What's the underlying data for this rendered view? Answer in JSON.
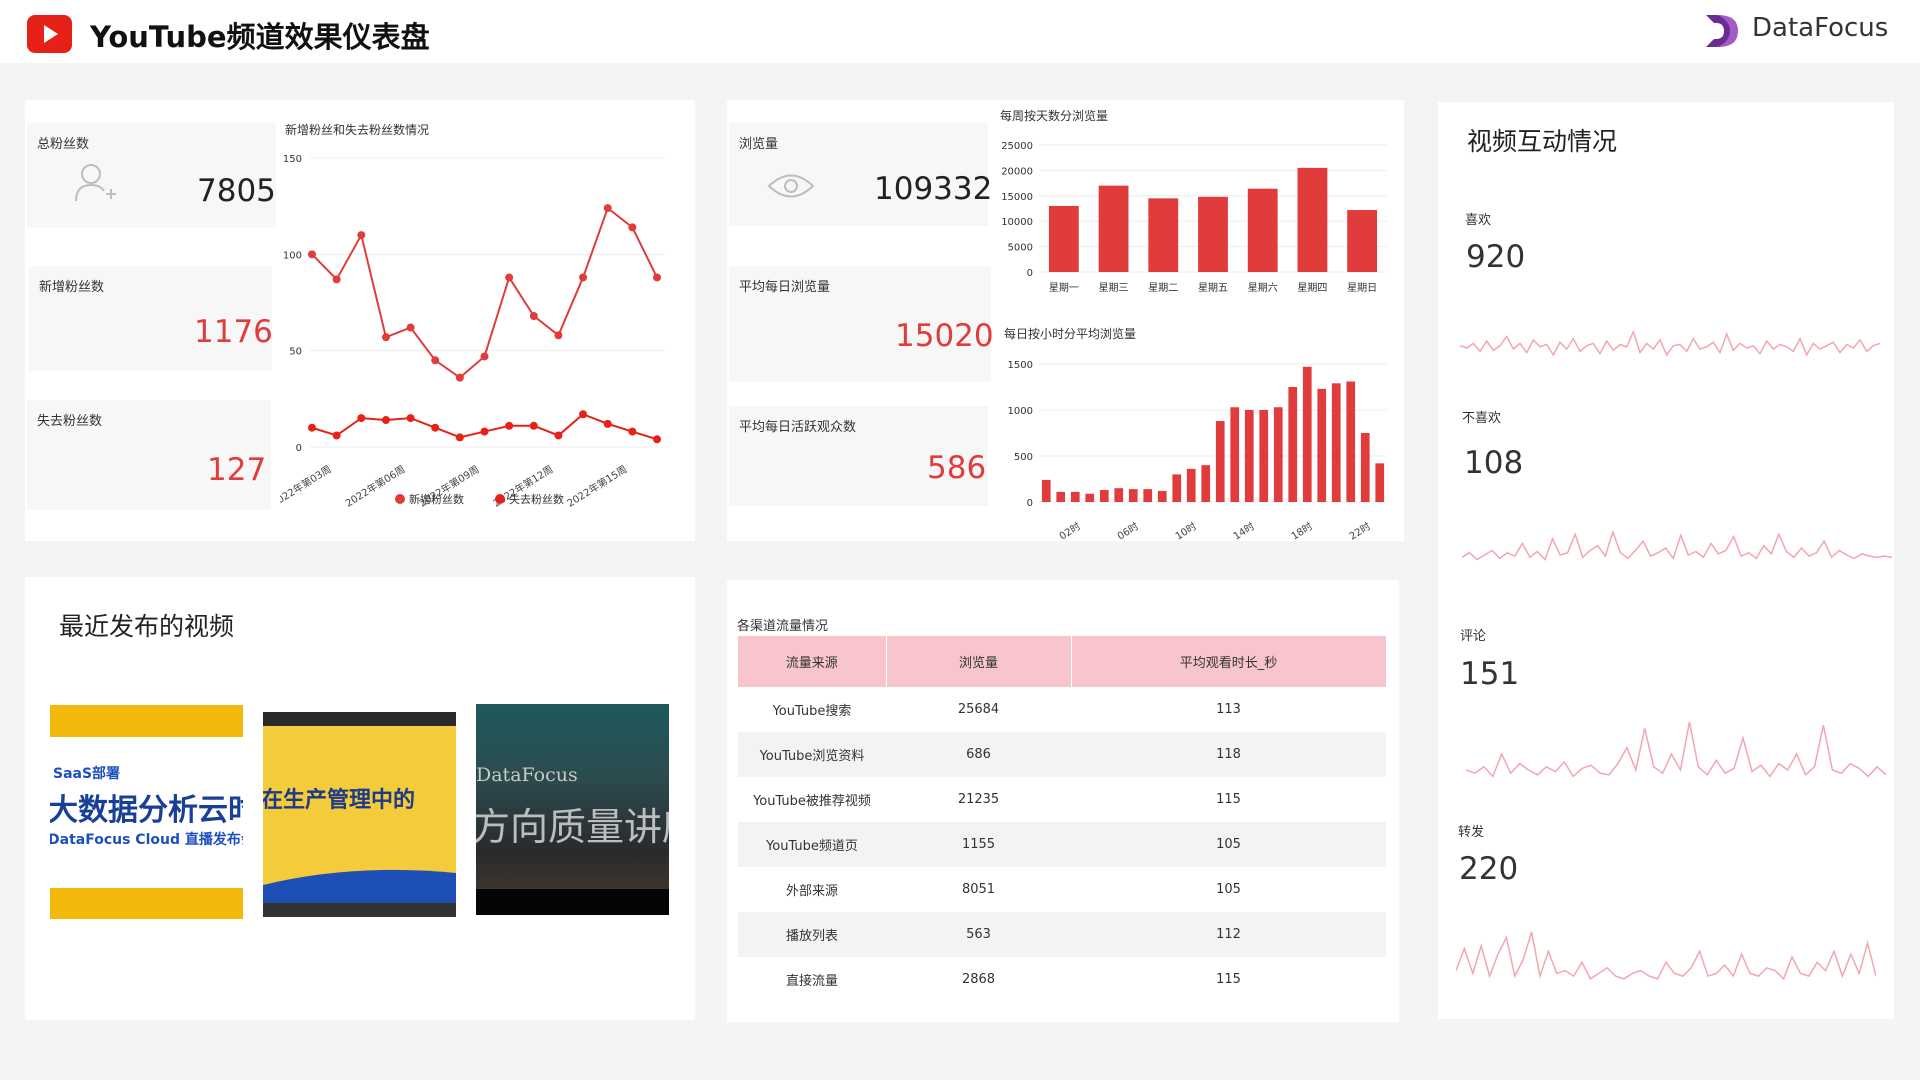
{
  "header": {
    "title": "YouTube频道效果仪表盘",
    "brand": "DataFocus"
  },
  "colors": {
    "accent": "#e03c3c",
    "youtube_red": "#e62117",
    "header_pink": "#f7c5cb",
    "sparkline": "#f4a5ae",
    "brand_purple": "#6a2c91"
  },
  "fans": {
    "total_label": "总粉丝数",
    "total_value": "7805",
    "total_icon": "user-add-icon",
    "new_label": "新增粉丝数",
    "new_value": "1176",
    "lost_label": "失去粉丝数",
    "lost_value": "127"
  },
  "views": {
    "views_label": "浏览量",
    "views_value": "109332",
    "views_icon": "eye-icon",
    "avg_daily_label": "平均每日浏览量",
    "avg_daily_value": "15020",
    "avg_active_label": "平均每日活跃观众数",
    "avg_active_value": "586"
  },
  "interaction": {
    "title": "视频互动情况",
    "like_label": "喜欢",
    "like_value": "920",
    "dislike_label": "不喜欢",
    "dislike_value": "108",
    "comment_label": "评论",
    "comment_value": "151",
    "share_label": "转发",
    "share_value": "220"
  },
  "recent": {
    "title": "最近发布的视频",
    "video1": {
      "line1": "SaaS部署",
      "line2": "大数据分析云时",
      "line3": "DataFocus Cloud 直播发布会"
    },
    "video2": {
      "line1": "在生产管理中的"
    },
    "video3": {
      "line1": "DataFocus",
      "line2": "方向质量讲座"
    }
  },
  "traffic": {
    "title": "各渠道流量情况",
    "columns": [
      "流量来源",
      "浏览量",
      "平均观看时长_秒"
    ],
    "rows": [
      [
        "YouTube搜索",
        "25684",
        "113"
      ],
      [
        "YouTube浏览资料",
        "686",
        "118"
      ],
      [
        "YouTube被推荐视频",
        "21235",
        "115"
      ],
      [
        "YouTube频道页",
        "1155",
        "105"
      ],
      [
        "外部来源",
        "8051",
        "105"
      ],
      [
        "播放列表",
        "563",
        "112"
      ],
      [
        "直接流量",
        "2868",
        "115"
      ]
    ]
  },
  "chart_data": [
    {
      "id": "fans",
      "type": "line",
      "title": "新增粉丝和失去粉丝数情况",
      "ylim": [
        0,
        150
      ],
      "yticks": [
        0,
        50,
        100,
        150
      ],
      "x": [
        "2022年第01周",
        "2022年第02周",
        "2022年第03周",
        "2022年第04周",
        "2022年第05周",
        "2022年第06周",
        "2022年第07周",
        "2022年第08周",
        "2022年第09周",
        "2022年第10周",
        "2022年第11周",
        "2022年第12周",
        "2022年第13周",
        "2022年第14周",
        "2022年第15周",
        "2022年第16周"
      ],
      "x_tick_labels": [
        "2022年第03周",
        "2022年第06周",
        "2022年第09周",
        "2022年第12周",
        "2022年第15周"
      ],
      "series": [
        {
          "name": "新增粉丝数",
          "color": "#e03c3c",
          "values": [
            100,
            87,
            110,
            57,
            62,
            45,
            36,
            47,
            88,
            68,
            58,
            88,
            124,
            114,
            88
          ]
        },
        {
          "name": "失去粉丝数",
          "color": "#e62117",
          "values": [
            10,
            6,
            15,
            14,
            15,
            10,
            5,
            8,
            11,
            11,
            6,
            17,
            12,
            8,
            4
          ]
        }
      ],
      "legend": "bottom"
    },
    {
      "id": "weekday",
      "type": "bar",
      "title": "每周按天数分浏览量",
      "ylim": [
        0,
        25000
      ],
      "yticks": [
        0,
        5000,
        10000,
        15000,
        20000,
        25000
      ],
      "categories": [
        "星期一",
        "星期三",
        "星期二",
        "星期五",
        "星期六",
        "星期四",
        "星期日"
      ],
      "values": [
        13000,
        17000,
        14500,
        14800,
        16400,
        20500,
        12200
      ],
      "color": "#e03c3c"
    },
    {
      "id": "hourly",
      "type": "bar",
      "title": "每日按小时分平均浏览量",
      "ylim": [
        0,
        1500
      ],
      "yticks": [
        0,
        500,
        1000,
        1500
      ],
      "categories": [
        "00时",
        "01时",
        "02时",
        "03时",
        "04时",
        "05时",
        "06时",
        "07时",
        "08时",
        "09时",
        "10时",
        "11时",
        "12时",
        "13时",
        "14时",
        "15时",
        "16时",
        "17时",
        "18时",
        "19时",
        "20时",
        "21时",
        "22时",
        "23时"
      ],
      "x_tick_labels": [
        "02时",
        "06时",
        "10时",
        "14时",
        "18时",
        "22时"
      ],
      "values": [
        240,
        110,
        110,
        90,
        130,
        150,
        140,
        140,
        120,
        300,
        360,
        400,
        880,
        1030,
        1000,
        1000,
        1030,
        1250,
        1470,
        1230,
        1290,
        1310,
        750,
        420
      ],
      "color": "#e03c3c"
    }
  ],
  "sparklines": {
    "like": [
      30,
      32,
      28,
      35,
      26,
      34,
      30,
      22,
      33,
      28,
      36,
      25,
      31,
      29,
      38,
      27,
      33,
      24,
      35,
      30,
      28,
      37,
      26,
      34,
      29,
      31,
      18,
      36,
      28,
      33,
      25,
      38,
      30,
      29,
      35,
      24,
      33,
      31,
      27,
      36,
      20,
      34,
      28,
      32,
      30,
      37,
      26,
      33,
      29,
      31,
      35,
      24,
      38,
      28,
      33,
      30,
      27,
      36,
      29,
      32,
      25,
      35,
      30,
      28
    ],
    "dislike": [
      34,
      30,
      36,
      32,
      28,
      35,
      30,
      33,
      22,
      34,
      29,
      36,
      18,
      32,
      30,
      14,
      34,
      28,
      24,
      33,
      12,
      30,
      35,
      28,
      20,
      33,
      30,
      26,
      35,
      15,
      32,
      29,
      34,
      22,
      31,
      28,
      16,
      33,
      30,
      35,
      24,
      31,
      14,
      29,
      34,
      26,
      33,
      30,
      20,
      34,
      28,
      32,
      35,
      31,
      33,
      34,
      33,
      34
    ],
    "comment": [
      40,
      42,
      38,
      44,
      30,
      42,
      36,
      40,
      43,
      38,
      41,
      35,
      44,
      39,
      37,
      42,
      43,
      36,
      26,
      40,
      14,
      38,
      42,
      30,
      40,
      10,
      38,
      43,
      34,
      42,
      39,
      20,
      41,
      37,
      44,
      36,
      40,
      30,
      43,
      38,
      12,
      40,
      42,
      36,
      39,
      44,
      38,
      43
    ],
    "share": [
      36,
      20,
      38,
      18,
      40,
      24,
      12,
      40,
      28,
      8,
      40,
      22,
      38,
      36,
      40,
      30,
      42,
      38,
      34,
      40,
      42,
      38,
      36,
      40,
      42,
      30,
      38,
      40,
      34,
      22,
      40,
      38,
      32,
      40,
      24,
      38,
      40,
      34,
      36,
      42,
      26,
      38,
      40,
      30,
      36,
      22,
      40,
      24,
      38,
      16,
      40
    ]
  }
}
